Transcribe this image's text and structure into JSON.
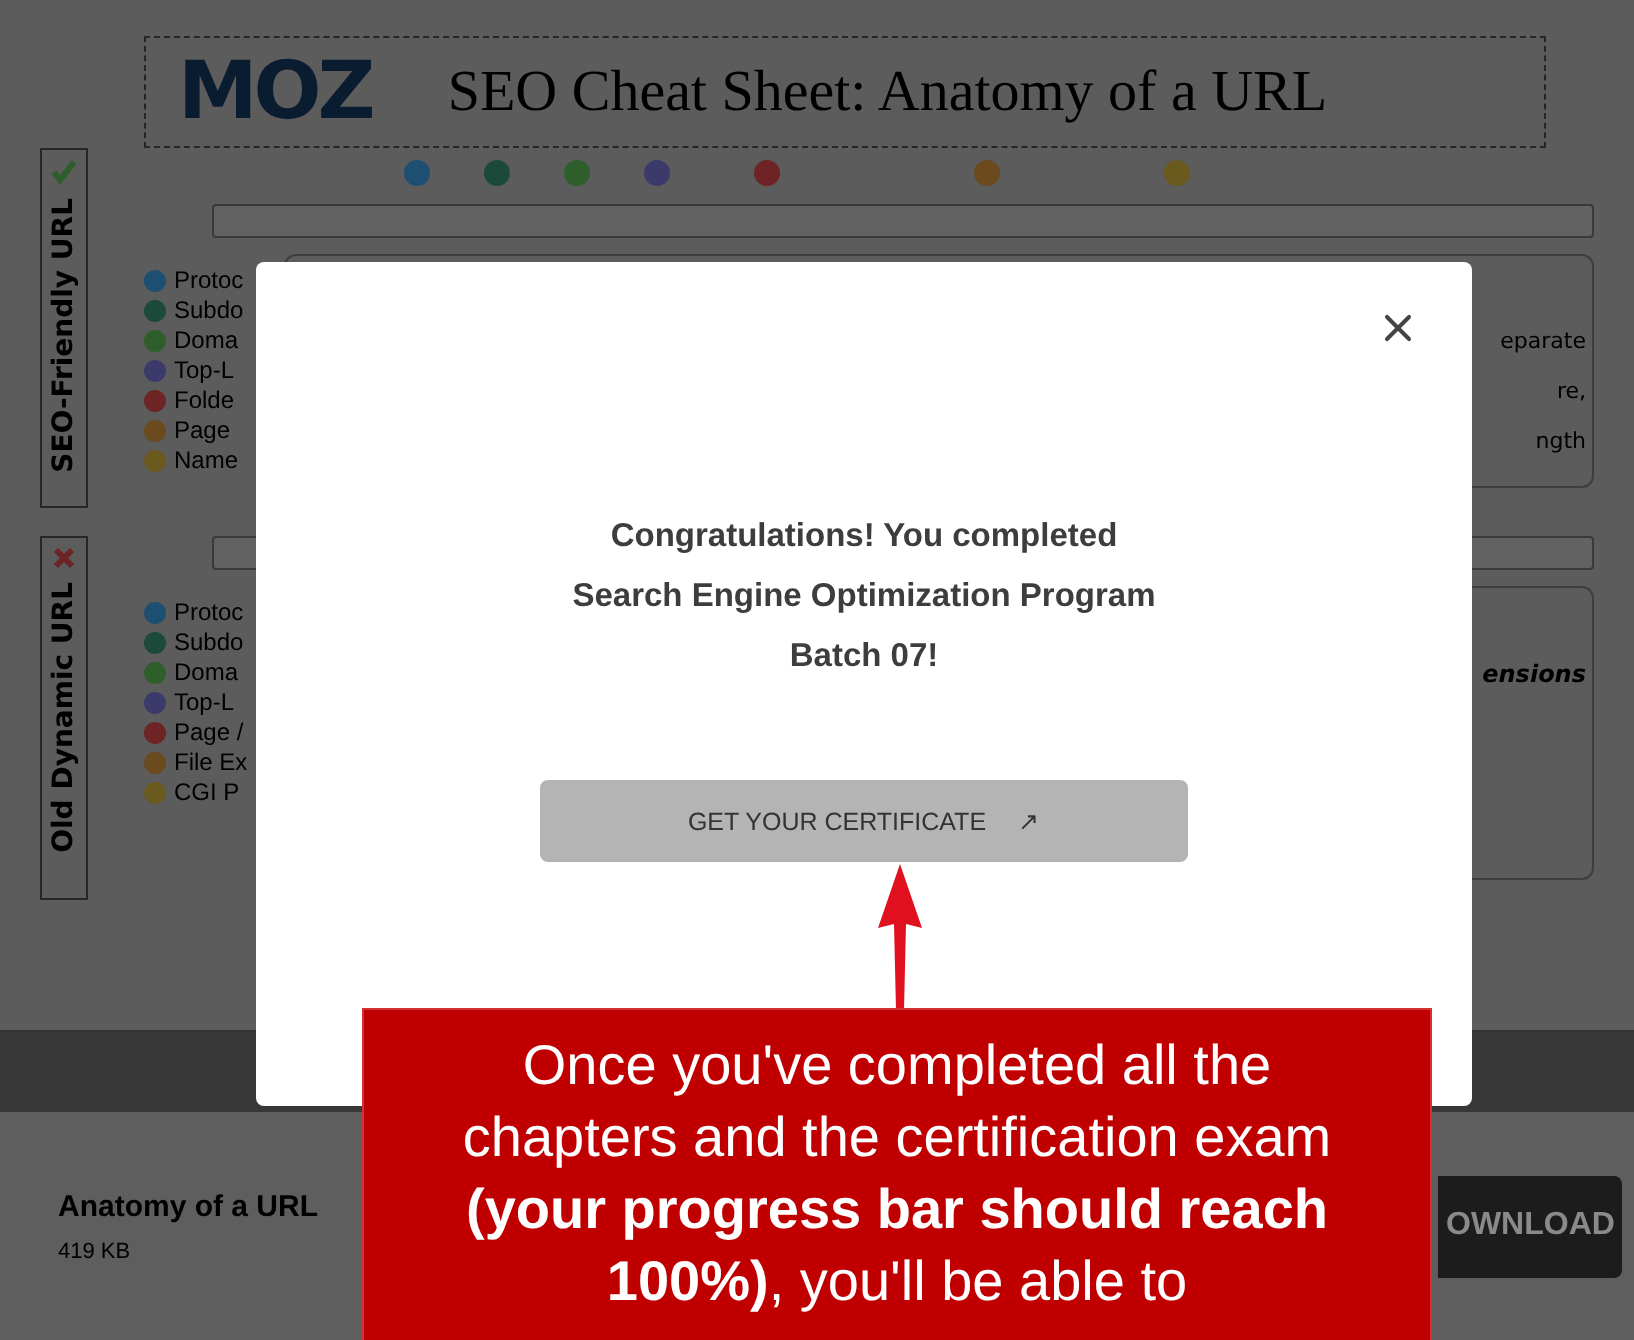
{
  "cheat_sheet": {
    "logo": "MOZ",
    "title": "SEO Cheat Sheet: Anatomy of a URL",
    "url_markers": [
      {
        "color": "#1d4f73"
      },
      {
        "color": "#1c4a3a"
      },
      {
        "color": "#2e5e2a"
      },
      {
        "color": "#3b3a6b"
      },
      {
        "color": "#6e2424"
      },
      {
        "color": "#6b4a1e"
      },
      {
        "color": "#6b5a1e"
      }
    ],
    "sections": [
      {
        "label": "SEO-Friendly URL",
        "kind": "good",
        "items": [
          {
            "label": "Protoc",
            "color": "#1d4f73"
          },
          {
            "label": "Subdo",
            "color": "#1c4a3a"
          },
          {
            "label": "Doma",
            "color": "#2e5e2a"
          },
          {
            "label": "Top-L",
            "color": "#3b3a6b"
          },
          {
            "label": "Folde",
            "color": "#6e2424"
          },
          {
            "label": "Page",
            "color": "#6b4a1e"
          },
          {
            "label": "Name",
            "color": "#6b5a1e"
          }
        ],
        "side_texts": [
          "eparate",
          "re,",
          "ngth"
        ]
      },
      {
        "label": "Old Dynamic URL",
        "kind": "bad",
        "items": [
          {
            "label": "Protoc",
            "color": "#1d4f73"
          },
          {
            "label": "Subdo",
            "color": "#1c4a3a"
          },
          {
            "label": "Doma",
            "color": "#2e5e2a"
          },
          {
            "label": "Top-L",
            "color": "#3b3a6b"
          },
          {
            "label": "Page /",
            "color": "#6e2424"
          },
          {
            "label": "File Ex",
            "color": "#6b4a1e"
          },
          {
            "label": "CGI P",
            "color": "#6b5a1e"
          }
        ],
        "side_texts": [
          "ensions"
        ]
      }
    ]
  },
  "file": {
    "name": "Anatomy of a URL",
    "size": "419 KB",
    "button": "OWNLOAD"
  },
  "modal": {
    "message_lines": [
      "Congratulations! You completed",
      "Search Engine Optimization Program",
      "Batch 07!"
    ],
    "button": "GET YOUR CERTIFICATE",
    "button_icon": "↗"
  },
  "callout": {
    "text": "Once you've completed all the chapters and the certification exam **(your progress bar should reach 100%)**, you'll be able to"
  }
}
